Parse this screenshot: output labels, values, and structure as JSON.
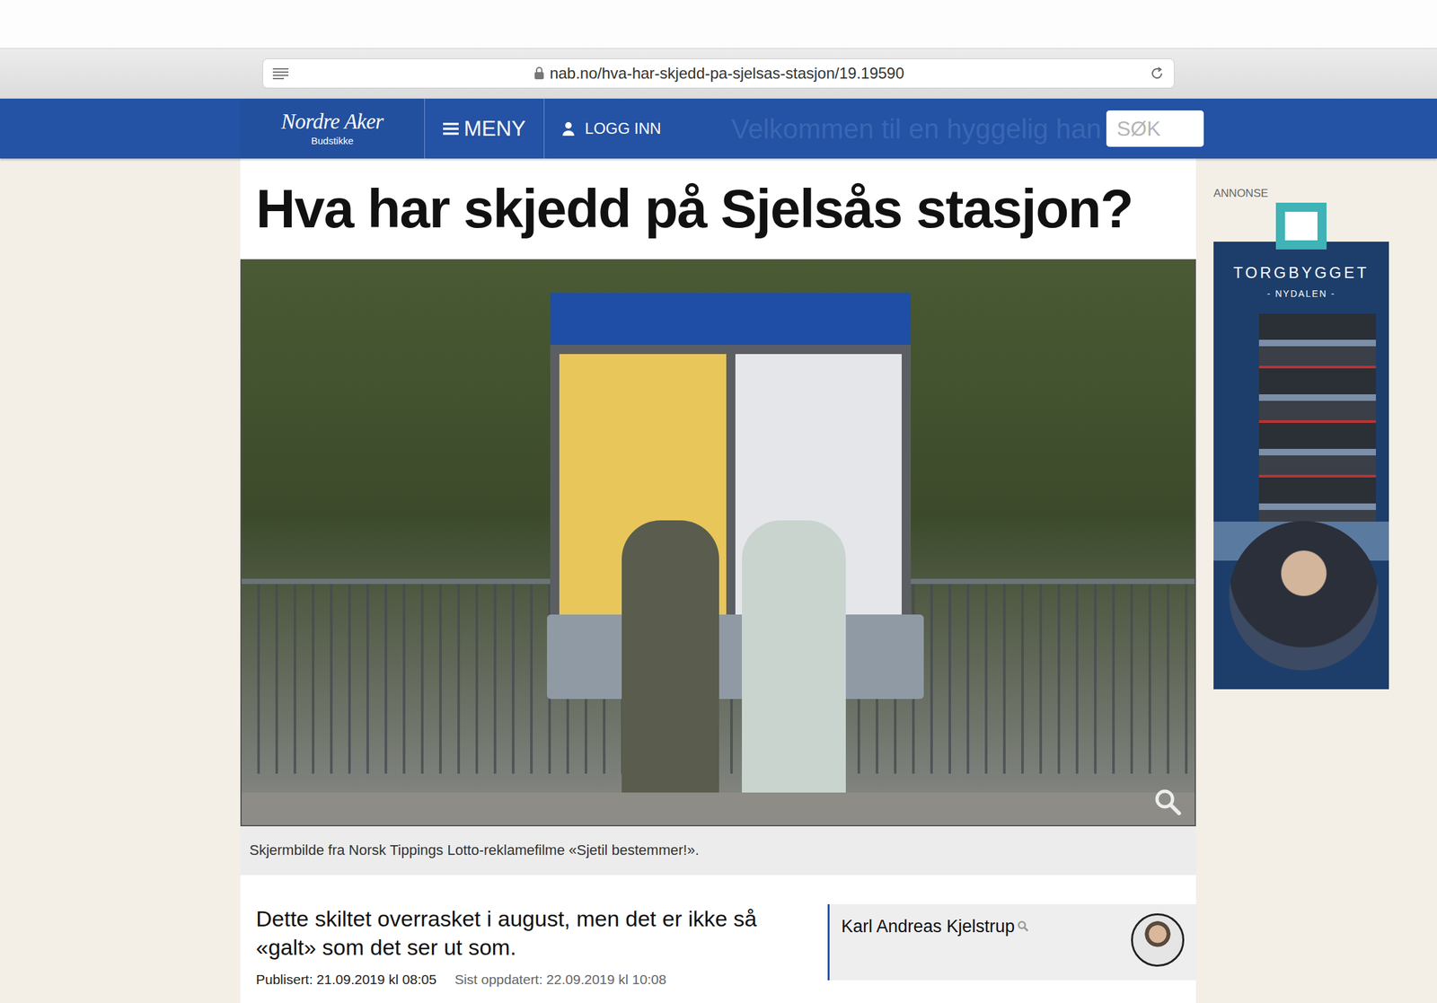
{
  "browser": {
    "url": "nab.no/hva-har-skjedd-pa-sjelsas-stasjon/19.19590"
  },
  "site": {
    "logo_title": "Nordre Aker",
    "logo_subtitle": "Budstikke",
    "menu": "MENY",
    "login": "LOGG INN",
    "search": "SØK",
    "banner_text": "Velkommen til en hyggelig han"
  },
  "article": {
    "title": "Hva har skjedd på Sjelsås stasjon?",
    "caption": "Skjermbilde fra Norsk Tippings Lotto-reklamefilme «Sjetil bestemmer!».",
    "lead": "Dette skiltet overrasket i august, men det er ikke så «galt» som det ser ut som.",
    "published": "Publisert: 21.09.2019 kl 08:05",
    "updated": "Sist oppdatert: 22.09.2019 kl 10:08",
    "author": "Karl Andreas Kjelstrup"
  },
  "ad": {
    "label": "ANNONSE",
    "brand": "TORGBYGGET",
    "location": "- NYDALEN -"
  }
}
